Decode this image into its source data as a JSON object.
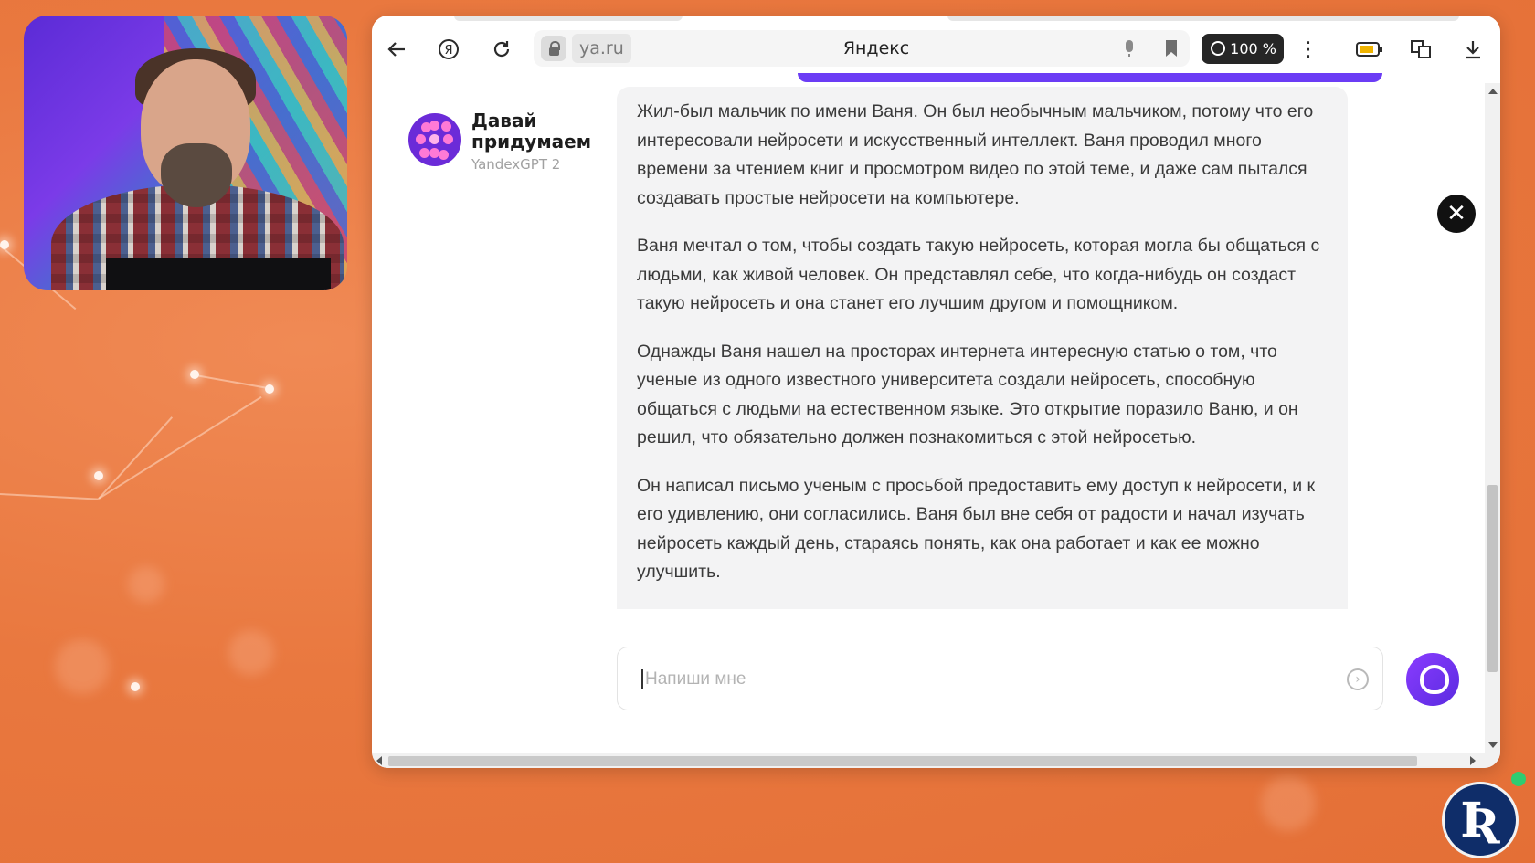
{
  "browser": {
    "domain": "ya.ru",
    "page_title": "Яндекс",
    "zoom_label": "100 %"
  },
  "bot": {
    "name": "Давай придумаем",
    "model": "YandexGPT 2"
  },
  "message": {
    "paragraphs": [
      "Жил-был мальчик по имени Ваня. Он был необычным мальчиком, потому что его интересовали нейросети и искусственный интеллект. Ваня проводил много времени за чтением книг и просмотром видео по этой теме, и даже сам пытался создавать простые нейросети на компьютере.",
      "Ваня мечтал о том, чтобы создать такую нейросеть, которая могла бы общаться с людьми, как живой человек. Он представлял себе, что когда-нибудь он создаст такую нейросеть и она станет его лучшим другом и помощником.",
      "Однажды Ваня нашел на просторах интернета интересную статью о том, что ученые из одного известного университета создали нейросеть, способную общаться с людьми на естественном языке. Это открытие поразило Ваню, и он решил, что обязательно должен познакомиться с этой нейросетью.",
      "Он написал письмо ученым с просьбой предоставить ему доступ к нейросети, и к его удивлению, они согласились. Ваня был вне себя от радости и начал изучать нейросеть каждый день, стараясь понять, как она работает и как ее можно улучшить."
    ]
  },
  "input": {
    "placeholder": "Напиши мне"
  },
  "colors": {
    "accent": "#6b3cf5",
    "background": "#e9783f",
    "bubble": "#f3f3f4"
  },
  "icons": [
    "back-icon",
    "yandex-icon",
    "reload-icon",
    "lock-icon",
    "mic-icon",
    "bookmark-icon",
    "zoom-icon",
    "more-icon",
    "battery-icon",
    "translate-icon",
    "download-icon",
    "close-icon",
    "send-icon",
    "alice-icon"
  ]
}
